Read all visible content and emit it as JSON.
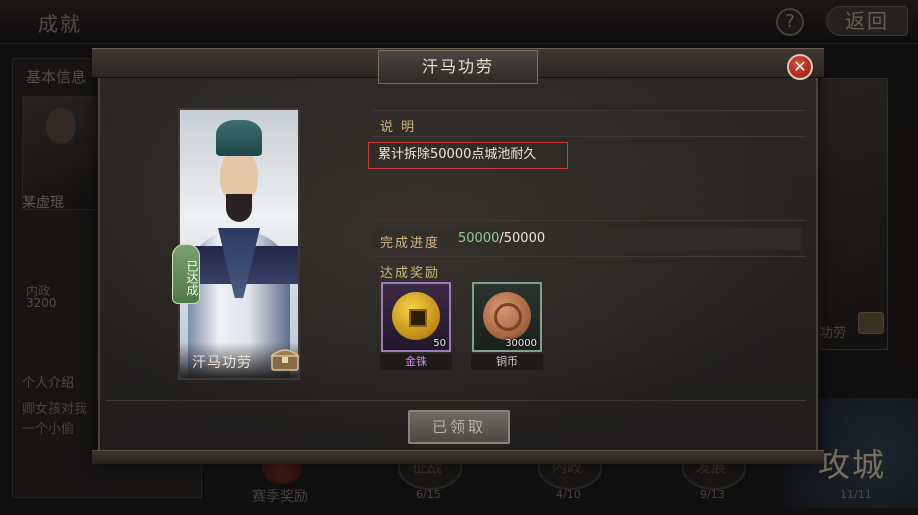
{
  "background": {
    "screen_title": "成就",
    "help_label": "?",
    "back_label": "返回",
    "left_panel": {
      "header": "基本信息",
      "hero_name": "某虚琨",
      "stat_label": "内政",
      "stat_value": "3200",
      "intro_header": "个人介绍",
      "intro_line1": "卿女孩对我",
      "intro_line2": "一个小偷"
    },
    "right_label": "功劳",
    "gongcheng_label": "攻城",
    "gongcheng_count": "11/11",
    "reward_tab_label": "赛季奖励",
    "tabs": [
      {
        "label": "征战",
        "count": "6/15"
      },
      {
        "label": "内政",
        "count": "4/10"
      },
      {
        "label": "发展",
        "count": "9/13"
      }
    ]
  },
  "modal": {
    "title": "汗马功劳",
    "close_label": "✕",
    "card": {
      "name": "汗马功劳",
      "done_badge": "已达成"
    },
    "description_label": "说 明",
    "description_text": "累计拆除50000点城池耐久",
    "progress_label": "完成进度",
    "progress_current": "50000",
    "progress_separator": "/",
    "progress_total": "50000",
    "rewards_label": "达成奖励",
    "rewards": [
      {
        "name": "金铢",
        "count": "50",
        "icon": "gold-coin-icon",
        "color": "#d484e8"
      },
      {
        "name": "铜币",
        "count": "30000",
        "icon": "copper-coin-icon",
        "color": "#cfc8bc"
      }
    ],
    "claim_button_label": "已领取"
  }
}
